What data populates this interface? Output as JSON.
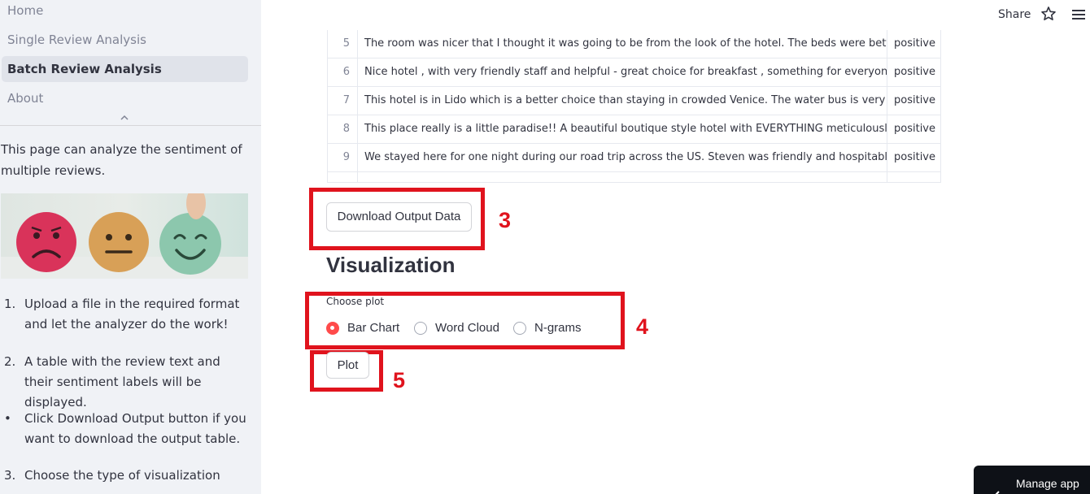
{
  "sidebar": {
    "nav": [
      {
        "label": "Home",
        "active": false
      },
      {
        "label": "Single Review Analysis",
        "active": false
      },
      {
        "label": "Batch Review Analysis",
        "active": true
      },
      {
        "label": "About",
        "active": false
      }
    ],
    "intro": "This page can analyze the sentiment of multiple reviews.",
    "steps": [
      {
        "marker": "1.",
        "text": "Upload a file in the required format and let the analyzer do the work!"
      },
      {
        "marker": "2.",
        "text": "A table with the review text and their sentiment labels will be displayed."
      },
      {
        "marker": "•",
        "text": "Click Download Output button if you want to download the output table."
      },
      {
        "marker": "3.",
        "text": "Choose the type of visualization"
      }
    ]
  },
  "header": {
    "share_label": "Share",
    "icons": [
      "star-icon",
      "hamburger-menu-icon"
    ]
  },
  "table": {
    "rows": [
      {
        "index": "5",
        "review": "The room was nicer that I thought it was going to be from the look of the hotel. The beds were better than I thou",
        "label": "positive"
      },
      {
        "index": "6",
        "review": "Nice hotel , with very friendly staff and helpful - great choice for breakfast , something for everyone.",
        "label": "positive"
      },
      {
        "index": "7",
        "review": "This hotel is in Lido which is a better choice than staying in crowded Venice. The water bus is very convenient a",
        "label": "positive"
      },
      {
        "index": "8",
        "review": "This place really is a little paradise!! A beautiful boutique style hotel with EVERYTHING meticulously thought ou",
        "label": "positive"
      },
      {
        "index": "9",
        "review": "We stayed here for one night during our road trip across the US. Steven was friendly and hospitable and the roc",
        "label": "positive"
      }
    ]
  },
  "main": {
    "download_button": "Download Output Data",
    "section_title": "Visualization",
    "radio_label": "Choose plot",
    "radio_options": [
      "Bar Chart",
      "Word Cloud",
      "N-grams"
    ],
    "radio_selected": "Bar Chart",
    "plot_button": "Plot"
  },
  "annotations": [
    "3",
    "4",
    "5"
  ],
  "footer": {
    "manage_app": "Manage app"
  },
  "colors": {
    "accent": "#ff4b4b",
    "annotation": "#e0131d",
    "sidebar_bg": "#f0f2f6"
  }
}
